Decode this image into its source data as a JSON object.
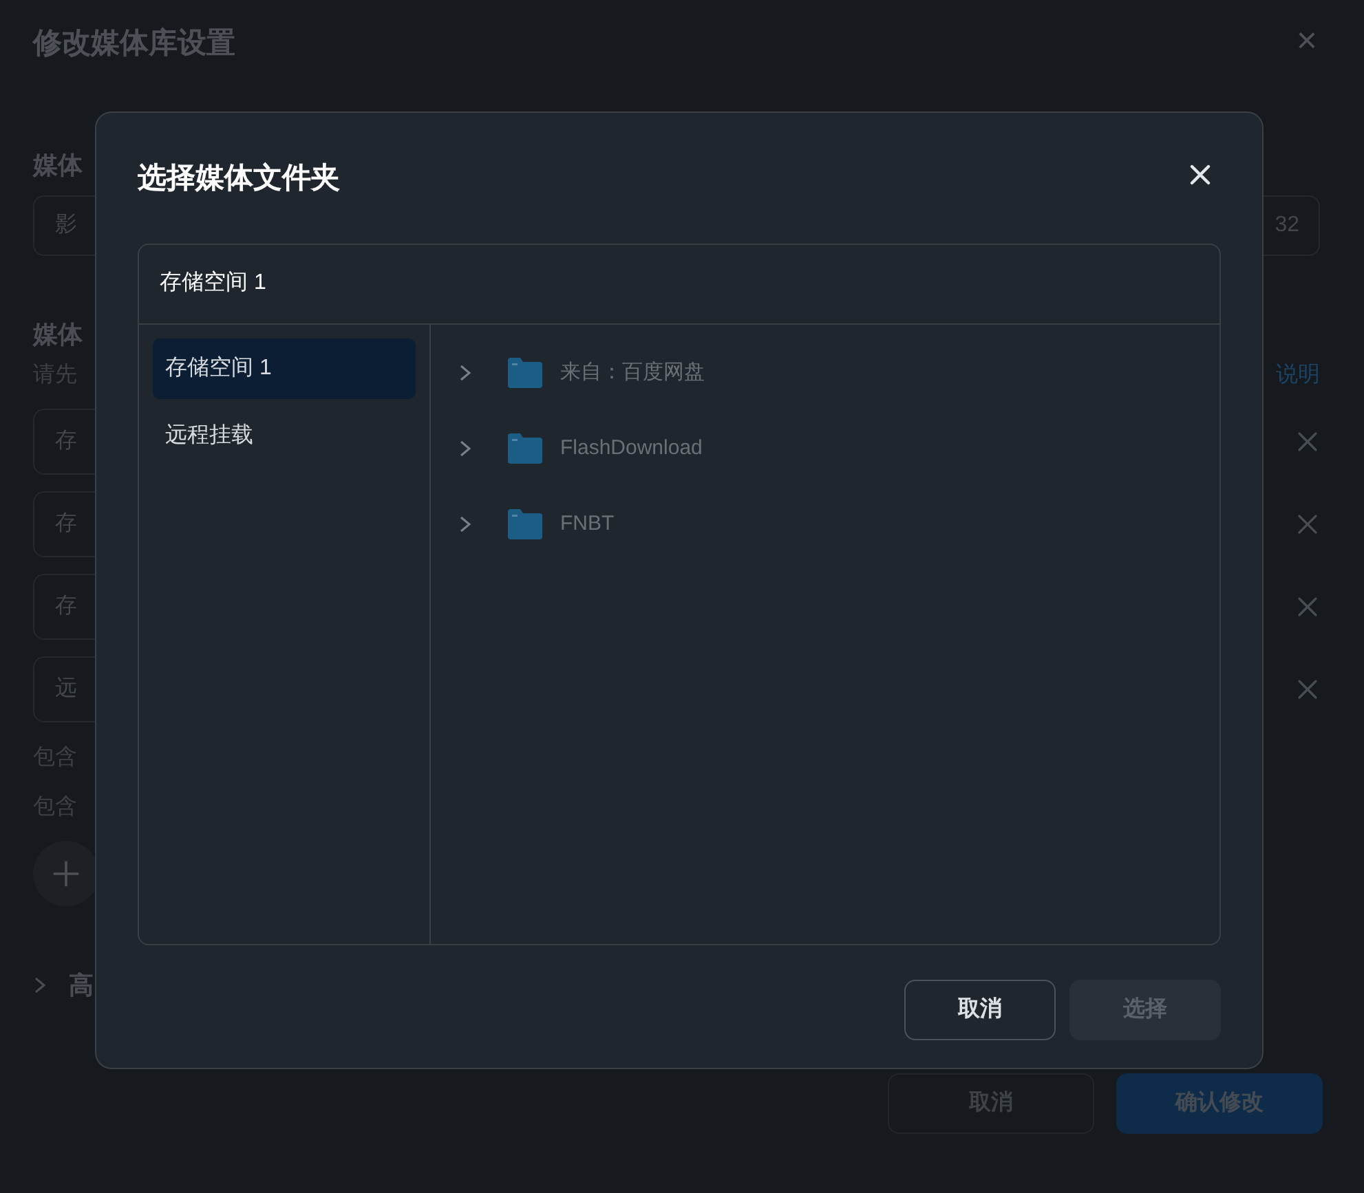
{
  "background_dialog": {
    "title": "修改媒体库设置",
    "close": "×",
    "library_label": "媒体",
    "name_field_value": "影",
    "count_text": "32",
    "folders_label": "媒体",
    "hint": "请先",
    "help_link": "说明",
    "folder_rows": [
      {
        "text": "存"
      },
      {
        "text": "存"
      },
      {
        "text": "存"
      },
      {
        "text": "远"
      }
    ],
    "options": [
      "包含",
      "包含"
    ],
    "advanced": "高",
    "buttons": [
      {
        "label": "取消",
        "kind": "secondary"
      },
      {
        "label": "确认修改",
        "kind": "primary"
      }
    ]
  },
  "modal": {
    "title": "选择媒体文件夹",
    "storage_header": "存储空间 1",
    "sources": [
      {
        "label": "存储空间 1",
        "selected": true
      },
      {
        "label": "远程挂载",
        "selected": false
      }
    ],
    "folders": [
      {
        "name": "来自：百度网盘"
      },
      {
        "name": "FlashDownload"
      },
      {
        "name": "FNBT"
      }
    ],
    "buttons": [
      {
        "label": "取消",
        "kind": "secondary",
        "disabled": false
      },
      {
        "label": "选择",
        "kind": "primary",
        "disabled": true
      }
    ]
  }
}
